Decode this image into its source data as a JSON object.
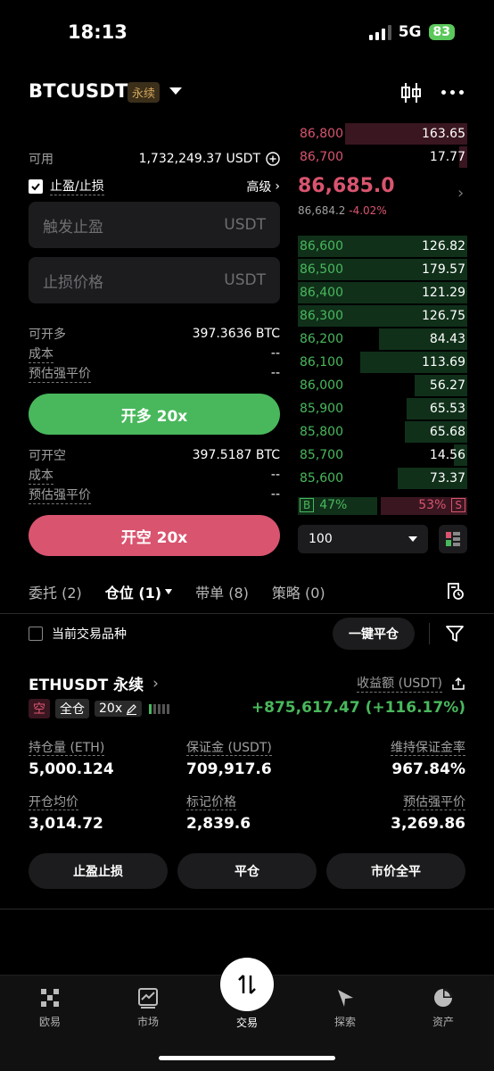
{
  "status_bar": {
    "time": "18:13",
    "network": "5G",
    "battery": "83"
  },
  "header": {
    "pair": "BTCUSDT",
    "badge": "永续"
  },
  "left": {
    "available_label": "可用",
    "available_value": "1,732,249.37 USDT",
    "tpsl_label": "止盈/止损",
    "advanced_label": "高级",
    "tp_placeholder": "触发止盈",
    "sl_placeholder": "止损价格",
    "unit": "USDT",
    "long": {
      "max_label": "可开多",
      "max_value": "397.3636 BTC",
      "cost_label": "成本",
      "cost_value": "--",
      "liq_label": "预估强平价",
      "liq_value": "--",
      "button": "开多 20x"
    },
    "short": {
      "max_label": "可开空",
      "max_value": "397.5187 BTC",
      "cost_label": "成本",
      "cost_value": "--",
      "liq_label": "预估强平价",
      "liq_value": "--",
      "button": "开空 20x"
    }
  },
  "orderbook": {
    "asks": [
      {
        "price": "86,800",
        "qty": "163.65",
        "depth": 0.72
      },
      {
        "price": "86,700",
        "qty": "17.77",
        "depth": 0.05
      }
    ],
    "last_price": "86,685.0",
    "mark_price": "86,684.2",
    "change": "-4.02%",
    "bids": [
      {
        "price": "86,600",
        "qty": "126.82",
        "depth": 1.0
      },
      {
        "price": "86,500",
        "qty": "179.57",
        "depth": 1.0
      },
      {
        "price": "86,400",
        "qty": "121.29",
        "depth": 1.0
      },
      {
        "price": "86,300",
        "qty": "126.75",
        "depth": 1.0
      },
      {
        "price": "86,200",
        "qty": "84.43",
        "depth": 0.52
      },
      {
        "price": "86,100",
        "qty": "113.69",
        "depth": 0.63
      },
      {
        "price": "86,000",
        "qty": "56.27",
        "depth": 0.31
      },
      {
        "price": "85,900",
        "qty": "65.53",
        "depth": 0.36
      },
      {
        "price": "85,800",
        "qty": "65.68",
        "depth": 0.37
      },
      {
        "price": "85,700",
        "qty": "14.56",
        "depth": 0.08
      },
      {
        "price": "85,600",
        "qty": "73.37",
        "depth": 0.41
      }
    ],
    "buy_label": "B",
    "buy_pct": "47%",
    "sell_pct": "53%",
    "sell_label": "S",
    "depth_select": "100"
  },
  "tabs": {
    "orders": "委托 (2)",
    "positions": "仓位 (1)",
    "copy": "带单 (8)",
    "strategy": "策略 (0)"
  },
  "filter": {
    "current_only": "当前交易品种",
    "close_all": "一键平仓"
  },
  "position": {
    "symbol": "ETHUSDT 永续",
    "side": "空",
    "margin_mode": "全仓",
    "leverage": "20x",
    "pnl_label": "收益额 (USDT)",
    "pnl_value": "+875,617.47 (+116.17%)",
    "size_label": "持仓量 (ETH)",
    "size_value": "5,000.124",
    "margin_label": "保证金 (USDT)",
    "margin_value": "709,917.6",
    "mmr_label": "维持保证金率",
    "mmr_value": "967.84%",
    "entry_label": "开仓均价",
    "entry_value": "3,014.72",
    "mark_label": "标记价格",
    "mark_value": "2,839.6",
    "liq_label": "预估强平价",
    "liq_value": "3,269.86",
    "btn_tpsl": "止盈止损",
    "btn_close": "平仓",
    "btn_market_close": "市价全平"
  },
  "nav": {
    "home": "欧易",
    "market": "市场",
    "trade": "交易",
    "explore": "探索",
    "assets": "资产"
  },
  "colors": {
    "green": "#49b85c",
    "red": "#d9546f",
    "gold": "#d2a45a"
  }
}
